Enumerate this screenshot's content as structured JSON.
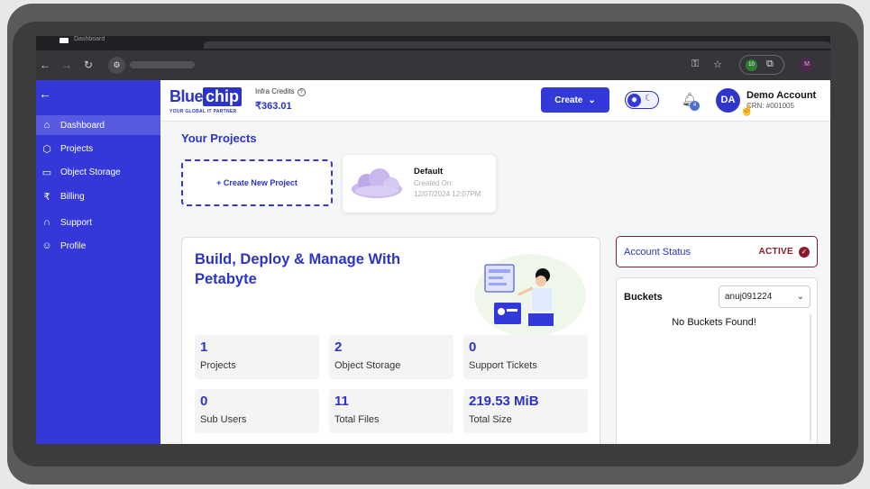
{
  "browser": {
    "tab_title": "Dashboard",
    "extension_badge": "10",
    "profile_initial": "M"
  },
  "sidebar": {
    "items": [
      {
        "label": "Dashboard",
        "icon": "home-icon"
      },
      {
        "label": "Projects",
        "icon": "cube-icon"
      },
      {
        "label": "Object Storage",
        "icon": "storage-icon"
      },
      {
        "label": "Billing",
        "icon": "rupee-icon"
      },
      {
        "label": "Support",
        "icon": "headset-icon"
      },
      {
        "label": "Profile",
        "icon": "user-icon"
      }
    ]
  },
  "header": {
    "logo_text_a": "Blue",
    "logo_text_b": "chip",
    "logo_tagline": "YOUR GLOBAL IT PARTNER",
    "credits_label": "Infra Credits",
    "credits_value": "₹363.01",
    "create_label": "Create",
    "notification_count": "4",
    "user_initials": "DA",
    "user_name": "Demo Account",
    "user_crn": "CRN: #001005"
  },
  "projects": {
    "title": "Your Projects",
    "new_label": "+ Create New Project",
    "cards": [
      {
        "name": "Default",
        "created_label": "Created On:",
        "created_date": "12/07/2024 12:07PM"
      }
    ]
  },
  "hero": {
    "title": "Build, Deploy & Manage With Petabyte",
    "stats": [
      {
        "value": "1",
        "label": "Projects"
      },
      {
        "value": "2",
        "label": "Object Storage"
      },
      {
        "value": "0",
        "label": "Support Tickets"
      },
      {
        "value": "0",
        "label": "Sub Users"
      },
      {
        "value": "11",
        "label": "Total Files"
      },
      {
        "value": "219.53 MiB",
        "label": "Total Size"
      }
    ]
  },
  "account": {
    "label": "Account Status",
    "status": "ACTIVE"
  },
  "buckets": {
    "title": "Buckets",
    "selected": "anuj091224",
    "empty_text": "No Buckets Found!"
  },
  "colors": {
    "brand": "#3338d8",
    "sidebar": "#3438d9",
    "status": "#8a1a2a"
  }
}
